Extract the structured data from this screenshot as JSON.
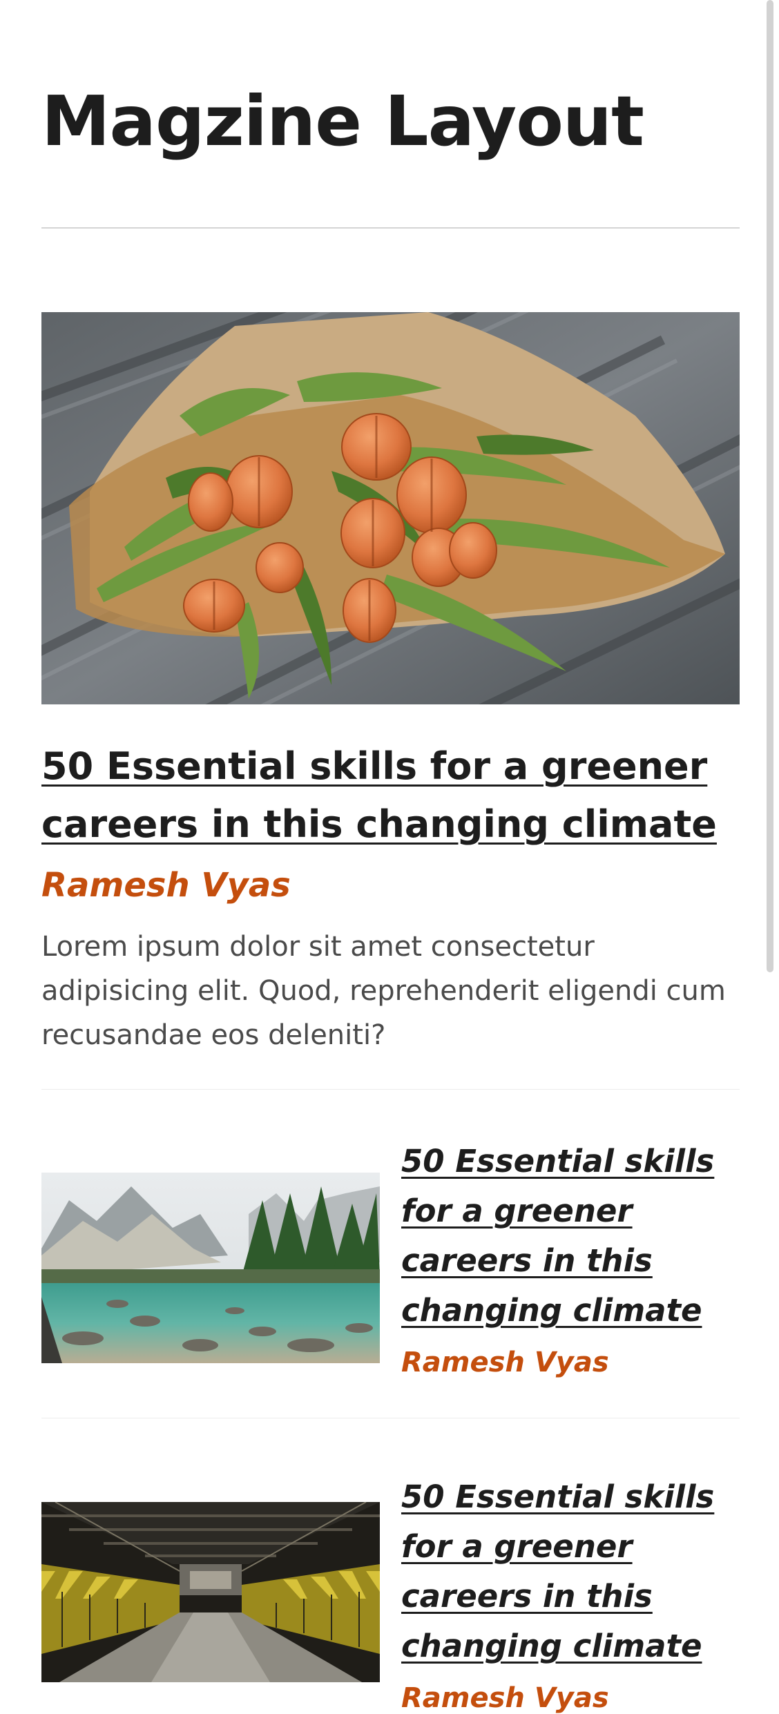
{
  "page": {
    "title": "Magzine Layout"
  },
  "featured": {
    "title": "50 Essential skills for a greener careers in this changing climate",
    "author": "Ramesh Vyas",
    "excerpt": "Lorem ipsum dolor sit amet consectetur adipisicing elit. Quod, reprehenderit eligendi cum recusandae eos deleniti?"
  },
  "articles": [
    {
      "title": "50 Essential skills for a greener careers in this changing climate",
      "author": "Ramesh Vyas"
    },
    {
      "title": "50 Essential skills for a greener careers in this changing climate",
      "author": "Ramesh Vyas"
    }
  ],
  "colors": {
    "accent": "#c44e0d",
    "text": "#1d1d1d",
    "body": "#4a4a4a"
  }
}
